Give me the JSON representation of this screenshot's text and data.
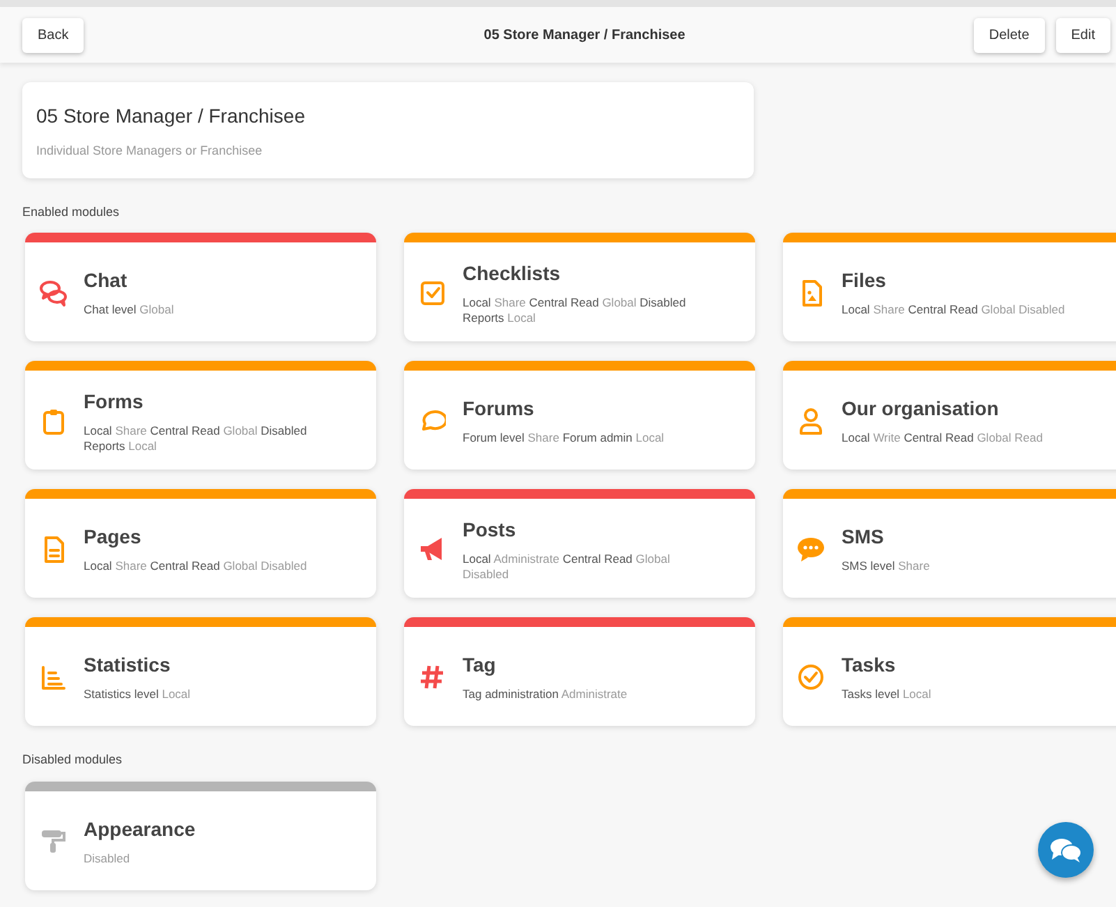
{
  "header": {
    "back": "Back",
    "title": "05 Store Manager / Franchisee",
    "actions": [
      "Delete",
      "Edit"
    ]
  },
  "role": {
    "name": "05 Store Manager / Franchisee",
    "description": "Individual Store Managers or Franchisee"
  },
  "sections": [
    {
      "heading": "Enabled modules",
      "modules": [
        {
          "title": "Chat",
          "description": "**Chat level** Global",
          "color": "#f44b4b"
        },
        {
          "title": "Checklists",
          "description": "**Local** Share **Central Read** Global **Disabled Reports** Local",
          "color": "#ff9800"
        },
        {
          "title": "Files",
          "description": "**Local** Share **Central Read** Global Disabled",
          "color": "#ff9800"
        },
        {
          "title": "Forms",
          "description": "**Local** Share **Central Read** Global **Disabled Reports** Local",
          "color": "#ff9800"
        },
        {
          "title": "Forums",
          "description": "**Forum level** Share **Forum admin** Local",
          "color": "#ff9800"
        },
        {
          "title": "Our organisation",
          "description": "**Local** Write **Central Read** Global Read",
          "color": "#ff9800"
        },
        {
          "title": "Pages",
          "description": "**Local** Share **Central Read** Global Disabled",
          "color": "#ff9800"
        },
        {
          "title": "Posts",
          "description": "**Local** Administrate **Central Read** Global Disabled",
          "color": "#f44b4b"
        },
        {
          "title": "SMS",
          "description": "**SMS level** Share",
          "color": "#ff9800"
        },
        {
          "title": "Statistics",
          "description": "**Statistics level** Local",
          "color": "#ff9800"
        },
        {
          "title": "Tag",
          "description": "**Tag administration** Administrate",
          "color": "#f44b4b"
        },
        {
          "title": "Tasks",
          "description": "**Tasks level** Local",
          "color": "#ff9800"
        }
      ]
    },
    {
      "heading": "Disabled modules",
      "modules": [
        {
          "title": "Appearance",
          "description": "Disabled",
          "color": "#b5b5b5"
        }
      ]
    }
  ]
}
